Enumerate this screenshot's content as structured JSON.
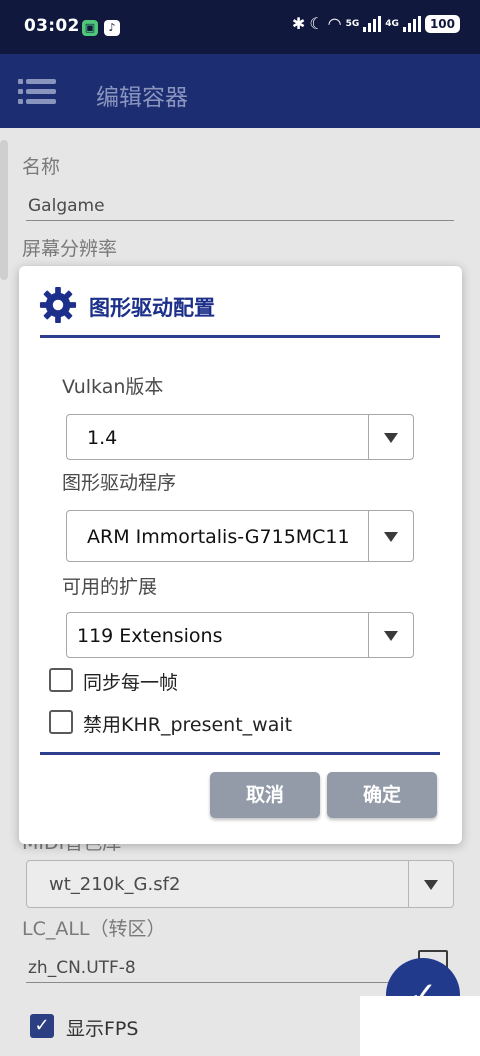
{
  "status_bar": {
    "time": "03:02",
    "network_5g": "5G",
    "network_4g": "4G",
    "battery": "100"
  },
  "app_bar": {
    "title": "编辑容器"
  },
  "background": {
    "name_label": "名称",
    "name_value": "Galgame",
    "resolution_label": "屏幕分辨率",
    "midi_label": "MIDI音色库",
    "midi_value": "wt_210k_G.sf2",
    "locale_label": "LC_ALL（转区）",
    "locale_value": "zh_CN.UTF-8",
    "show_fps_label": "显示FPS",
    "show_fps_checked": true
  },
  "dialog": {
    "title": "图形驱动配置",
    "vulkan_label": "Vulkan版本",
    "vulkan_value": "1.4",
    "driver_label": "图形驱动程序",
    "driver_value": "ARM Immortalis-G715MC11",
    "extensions_label": "可用的扩展",
    "extensions_value": "119 Extensions",
    "sync_frame_label": "同步每一帧",
    "sync_frame_checked": false,
    "disable_khr_label": "禁用KHR_present_wait",
    "disable_khr_checked": false,
    "cancel_label": "取消",
    "confirm_label": "确定"
  },
  "colors": {
    "status_bar": "#10183e",
    "app_bar": "#1c2d72",
    "accent": "#1c2f8a",
    "button": "#939ba8"
  }
}
